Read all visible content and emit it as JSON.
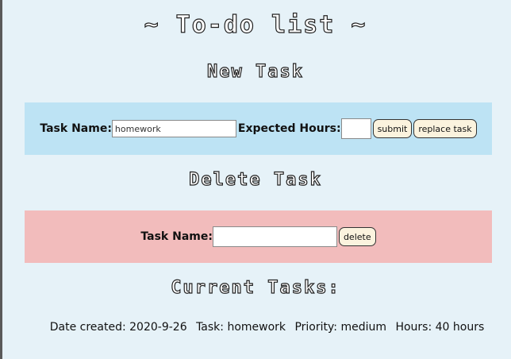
{
  "page": {
    "title": "~ To-do list ~"
  },
  "new_task": {
    "heading": "New Task",
    "task_name_label": "Task Name:",
    "task_name_value": "homework",
    "expected_hours_label": "Expected Hours:",
    "expected_hours_value": "",
    "submit_label": "submit",
    "replace_label": "replace task"
  },
  "delete_task": {
    "heading": "Delete Task",
    "task_name_label": "Task Name:",
    "task_name_value": "",
    "delete_label": "delete"
  },
  "current_tasks": {
    "heading": "Current Tasks:",
    "items": [
      {
        "date_created": "Date created: 2020-9-26",
        "task": "Task: homework",
        "priority": "Priority: medium",
        "hours": "Hours: 40 hours"
      }
    ]
  },
  "colors": {
    "page_bg": "#e6f2f8",
    "new_band": "#bde3f4",
    "delete_band": "#f2bcbc",
    "button_bg": "#fbf3de"
  }
}
